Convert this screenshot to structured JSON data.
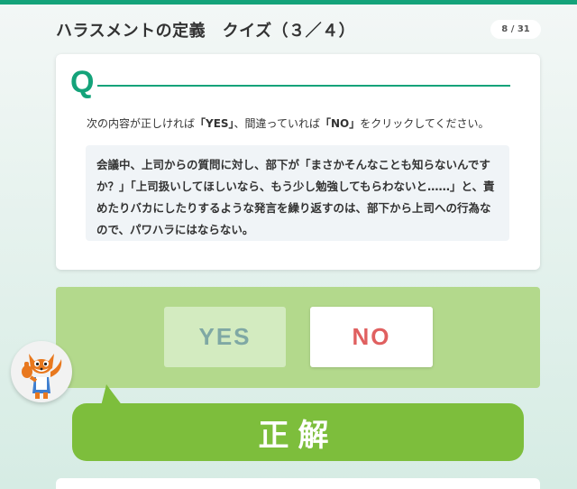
{
  "header": {
    "title": "ハラスメントの定義　クイズ（３／４）",
    "counter": "8 / 31"
  },
  "question": {
    "letter": "Q",
    "instruction": {
      "before": "次の内容が正しければ",
      "yes_term": "「YES」",
      "middle": "、間違っていれば",
      "no_term": "「NO」",
      "after": "をクリックしてください。"
    },
    "statement": "会議中、上司からの質問に対し、部下が「まさかそんなことも知らないんですか？」「上司扱いしてほしいなら、もう少し勉強してもらわないと……」と、責めたりバカにしたりするような発言を繰り返すのは、部下から上司への行為なので、パワハラにはならない。"
  },
  "answers": {
    "yes_label": "YES",
    "no_label": "NO"
  },
  "result": {
    "label": "正解"
  },
  "colors": {
    "accent": "#14a37a",
    "answer_panel": "#b3d98c",
    "result_bubble": "#7dbe3c",
    "no_text": "#e06060"
  }
}
